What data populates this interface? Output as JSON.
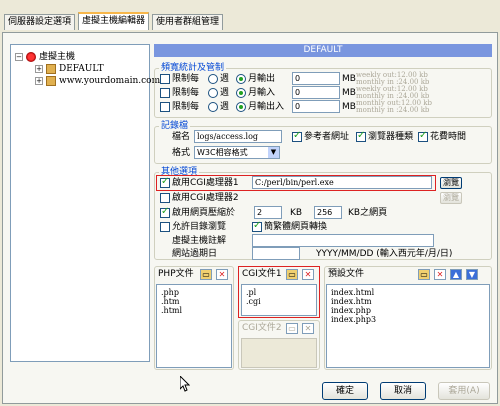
{
  "tabs": [
    "伺服器設定選項",
    "虛擬主機編輯器",
    "使用者群組管理"
  ],
  "tree": {
    "root": "虛擬主機",
    "children": [
      "DEFAULT",
      "www.yourdomain.com"
    ]
  },
  "header": "DEFAULT",
  "bandwidth": {
    "title": "頻寬統計及管制",
    "rows": [
      {
        "limit": "限制每",
        "week": "週",
        "month": "月輸出",
        "value": "0",
        "unit": "MB",
        "hint1": "weekly out:12.00 kb",
        "hint2": "monthly in :24.00 kb"
      },
      {
        "limit": "限制每",
        "week": "週",
        "month": "月輸入",
        "value": "0",
        "unit": "MB",
        "hint1": "weekly out:12.00 kb",
        "hint2": "monthly in :24.00 kb"
      },
      {
        "limit": "限制每",
        "week": "週",
        "month": "月輸出入",
        "value": "0",
        "unit": "MB",
        "hint1": "monthly out:12.00 kb",
        "hint2": "monthly in :24.00 kb"
      }
    ]
  },
  "log": {
    "title": "記錄檔",
    "filename_label": "檔名",
    "filename_value": "logs/access.log",
    "format_label": "格式",
    "format_value": "W3C相容格式",
    "check_referer": "參考者網址",
    "check_browser": "瀏覽器種類",
    "check_time": "花費時間"
  },
  "other": {
    "title": "其他選項",
    "cgi1_label": "啟用CGI處理器1",
    "cgi1_value": "C:/perl/bin/perl.exe",
    "cgi2_label": "啟用CGI處理器2",
    "browse": "瀏覽",
    "compress_label": "啟用網頁壓縮於",
    "compress_min": "2",
    "kb": "KB",
    "compress_max": "256",
    "kb_page": "KB之網頁",
    "dir_browse": "允許目錄瀏覽",
    "simplified": "簡繁體網頁轉換",
    "vhost_note": "虛擬主機註解",
    "expiry_label": "網站過期日",
    "expiry_hint": "YYYY/MM/DD (輸入西元年/月/日)"
  },
  "lists": {
    "php": {
      "title": "PHP文件",
      "items": [
        ".php",
        ".htm",
        ".html"
      ]
    },
    "cgi1": {
      "title": "CGI文件1",
      "items": [
        ".pl",
        ".cgi"
      ]
    },
    "cgi2": {
      "title": "CGI文件2"
    },
    "default": {
      "title": "預設文件",
      "items": [
        "index.html",
        "index.htm",
        "index.php",
        "index.php3"
      ]
    }
  },
  "buttons": {
    "ok": "確定",
    "cancel": "取消",
    "apply": "套用(A)"
  },
  "colors": {
    "header": "#7a96df",
    "highlight": "#d22222",
    "check": "#21a121"
  }
}
